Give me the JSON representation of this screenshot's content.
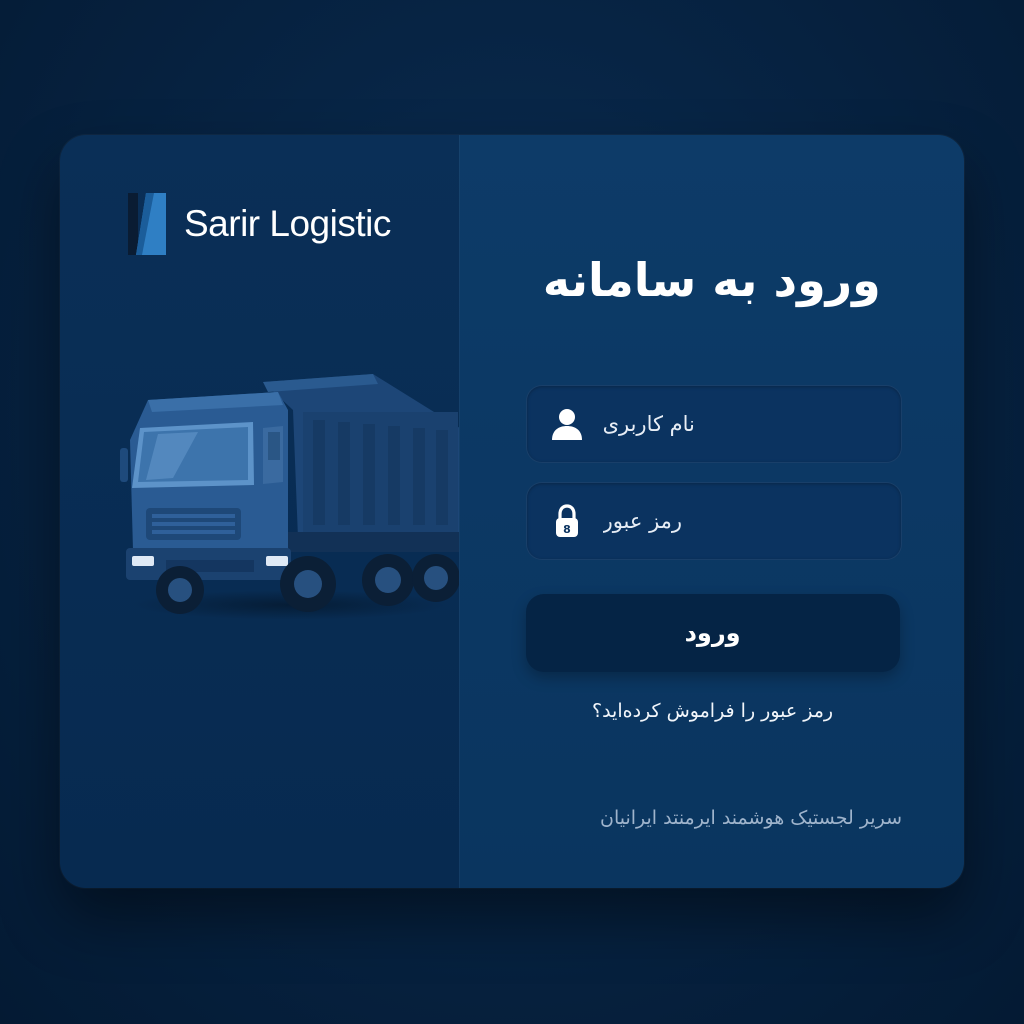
{
  "brand": {
    "name": "Sarir Logistic"
  },
  "login": {
    "title": "ورود به سامانه",
    "username_placeholder": "نام کاربری",
    "password_placeholder": "رمز عبور",
    "password_badge": "8",
    "submit_label": "ورود",
    "forgot_link": "رمز عبور را فراموش کرده‌اید؟"
  },
  "footer": {
    "text": "سریر لجستیک هوشمند ایرمنتد ایرانیان"
  },
  "icons": {
    "username": "user-icon",
    "password": "lock-icon",
    "brand": "brand-logo",
    "illustration": "dump-truck-illustration"
  },
  "colors": {
    "background": "#061f3d",
    "left_panel": "#0a2f57",
    "right_panel": "#0d3b68",
    "field": "#0b3360",
    "button": "#052445",
    "text": "#ffffff",
    "muted_text": "#9fb4cc"
  }
}
